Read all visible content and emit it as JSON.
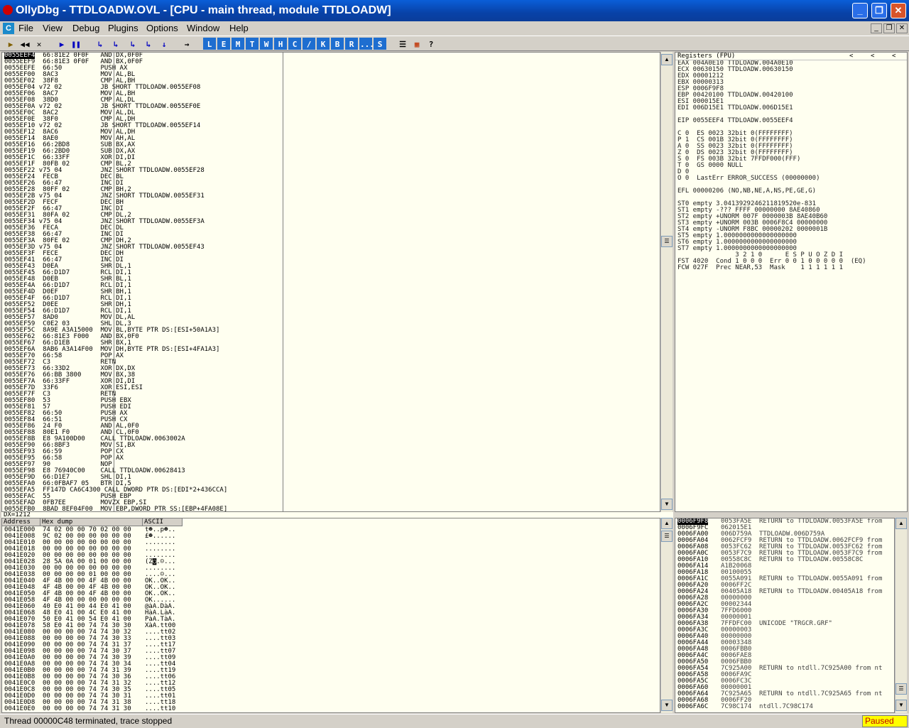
{
  "window": {
    "title": "OllyDbg - TTDLOADW.OVL - [CPU - main thread, module TTDLOADW]",
    "minimize": "_",
    "restore": "❐",
    "close": "✕"
  },
  "menu": {
    "sys": "C",
    "items": [
      "File",
      "View",
      "Debug",
      "Plugins",
      "Options",
      "Window",
      "Help"
    ],
    "mdi_min": "_",
    "mdi_restore": "❐",
    "mdi_close": "✕"
  },
  "toolbar": {
    "buttons": [
      "▶",
      "◀◀",
      "✕",
      "▶",
      "❚❚",
      "↳",
      "↳",
      "↳",
      "↳",
      "↓",
      "↑",
      "→"
    ],
    "letters": [
      "L",
      "E",
      "M",
      "T",
      "W",
      "H",
      "C",
      "/",
      "K",
      "B",
      "R",
      "...",
      "S"
    ],
    "extra": [
      "☰",
      "▦",
      "?"
    ]
  },
  "disasm": {
    "scroll_up": "▲",
    "scroll_down": "▼",
    "scroll_mid": "☰",
    "rows": [
      "0055EEF4  66:81E2 0F0F   AND DX,0F0F",
      "0055EEF9  66:81E3 0F0F   AND BX,0F0F",
      "0055EEFE  66:50          PUSH AX",
      "0055EF00  8AC3           MOV AL,BL",
      "0055EF02  38F8           CMP AL,BH",
      "0055EF04 v72 02          JB SHORT TTDLOADW.0055EF08",
      "0055EF06  8AC7           MOV AL,BH",
      "0055EF08  38D0           CMP AL,DL",
      "0055EF0A v72 02          JB SHORT TTDLOADW.0055EF0E",
      "0055EF0C  8AC2           MOV AL,DL",
      "0055EF0E  38F0           CMP AL,DH",
      "0055EF10 v72 02          JB SHORT TTDLOADW.0055EF14",
      "0055EF12  8AC6           MOV AL,DH",
      "0055EF14  8AE0           MOV AH,AL",
      "0055EF16  66:2BD8        SUB BX,AX",
      "0055EF19  66:2BD0        SUB DX,AX",
      "0055EF1C  66:33FF        XOR DI,DI",
      "0055EF1F  80FB 02        CMP BL,2",
      "0055EF22 v75 04          JNZ SHORT TTDLOADW.0055EF28",
      "0055EF24  FECB           DEC BL",
      "0055EF26  66:47          INC DI",
      "0055EF28  80FF 02        CMP BH,2",
      "0055EF2B v75 04          JNZ SHORT TTDLOADW.0055EF31",
      "0055EF2D  FECF           DEC BH",
      "0055EF2F  66:47          INC DI",
      "0055EF31  80FA 02        CMP DL,2",
      "0055EF34 v75 04          JNZ SHORT TTDLOADW.0055EF3A",
      "0055EF36  FECA           DEC DL",
      "0055EF38  66:47          INC DI",
      "0055EF3A  80FE 02        CMP DH,2",
      "0055EF3D v75 04          JNZ SHORT TTDLOADW.0055EF43",
      "0055EF3F  FECE           DEC DH",
      "0055EF41  66:47          INC DI",
      "0055EF43  D0EA           SHR DL,1",
      "0055EF45  66:D1D7        RCL DI,1",
      "0055EF48  D0EB           SHR BL,1",
      "0055EF4A  66:D1D7        RCL DI,1",
      "0055EF4D  D0EF           SHR BH,1",
      "0055EF4F  66:D1D7        RCL DI,1",
      "0055EF52  D0EE           SHR DH,1",
      "0055EF54  66:D1D7        RCL DI,1",
      "0055EF57  8AD0           MOV DL,AL",
      "0055EF59  C0E2 03        SHL DL,3",
      "0055EF5C  8A9E A3A15000  MOV BL,BYTE PTR DS:[ESI+50A1A3]",
      "0055EF62  66:81E3 F000   AND BX,0F0",
      "0055EF67  66:D1EB        SHR BX,1",
      "0055EF6A  8AB6 A3A14F00  MOV DH,BYTE PTR DS:[ESI+4FA1A3]",
      "0055EF70  66:58          POP AX",
      "0055EF72  C3             RETN",
      "0055EF73  66:33D2        XOR DX,DX",
      "0055EF76  66:BB 3800     MOV BX,38",
      "0055EF7A  66:33FF        XOR DI,DI",
      "0055EF7D  33F6           XOR ESI,ESI",
      "0055EF7F  C3             RETN",
      "0055EF80  53             PUSH EBX",
      "0055EF81  57             PUSH EDI",
      "0055EF82  66:50          PUSH AX",
      "0055EF84  66:51          PUSH CX",
      "0055EF86  24 F0          AND AL,0F0",
      "0055EF88  80E1 F0        AND CL,0F0",
      "0055EF8B  E8 9A100D00    CALL TTDLOADW.0063002A",
      "0055EF90  66:8BF3        MOV SI,BX",
      "0055EF93  66:59          POP CX",
      "0055EF95  66:58          POP AX",
      "0055EF97  90             NOP",
      "0055EF98  E8 76940C00    CALL TTDLOADW.00628413",
      "0055EF9D  66:D1E7        SHL DI,1",
      "0055EFA0  66:0FBAF7 05   BTR DI,5",
      "0055EFA5  FF147D CA6C4300 CALL DWORD PTR DS:[EDI*2+436CCA]",
      "0055EFAC  55             PUSH EBP",
      "0055EFAD  0FB7EE         MOVZX EBP,SI",
      "0055EFB0  8BAD 8EF04F00  MOV EBP,DWORD PTR SS:[EBP+4FA08E]"
    ]
  },
  "info": {
    "text": "DX=1212"
  },
  "registers": {
    "header": "Registers (FPU)",
    "arrows": [
      "<",
      "<",
      "<"
    ],
    "rows": [
      "EAX 004A0E10 TTDLOADW.004A0E10",
      "ECX 00630150 TTDLOADW.00630150",
      "EDX 00001212",
      "EBX 00000313",
      "ESP 0006F9F8",
      "EBP 00420100 TTDLOADW.00420100",
      "ESI 000015E1",
      "EDI 006D15E1 TTDLOADW.006D15E1",
      "",
      "EIP 0055EEF4 TTDLOADW.0055EEF4",
      "",
      "C 0  ES 0023 32bit 0(FFFFFFFF)",
      "P 1  CS 001B 32bit 0(FFFFFFFF)",
      "A 0  SS 0023 32bit 0(FFFFFFFF)",
      "Z 0  DS 0023 32bit 0(FFFFFFFF)",
      "S 0  FS 003B 32bit 7FFDF000(FFF)",
      "T 0  GS 0000 NULL",
      "D 0",
      "O 0  LastErr ERROR_SUCCESS (00000000)",
      "",
      "EFL 00000206 (NO,NB,NE,A,NS,PE,GE,G)",
      "",
      "ST0 empty 3.0413929246211819520e-831",
      "ST1 empty -??? FFFF 00000000 8AE40860",
      "ST2 empty +UNORM 007F 0000003B 8AE40B60",
      "ST3 empty +UNORM 003B 0006F8C4 00000000",
      "ST4 empty -UNORM F8BC 00000202 0000001B",
      "ST5 empty 1.0000000000000000000",
      "ST6 empty 1.0000000000000000000",
      "ST7 empty 1.0000000000000000000",
      "               3 2 1 0      E S P U O Z D I",
      "FST 4020  Cond 1 0 0 0  Err 0 0 1 0 0 0 0 0  (EQ)",
      "FCW 027F  Prec NEAR,53  Mask    1 1 1 1 1 1"
    ]
  },
  "dump": {
    "headers": [
      "Address",
      "Hex dump",
      "ASCII"
    ],
    "rows": [
      [
        "0041E000",
        "74 02 00 00 70 02 00 00",
        "t☻..p☻.."
      ],
      [
        "0041E008",
        "9C 02 00 00 00 00 00 00",
        "£☻......"
      ],
      [
        "0041E010",
        "00 00 00 00 00 00 00 00",
        "........"
      ],
      [
        "0041E018",
        "00 00 00 00 00 00 00 00",
        "........"
      ],
      [
        "0041E020",
        "00 00 00 00 00 00 00 00",
        "........"
      ],
      [
        "0041E028",
        "28 5A 0A 00 01 00 00 00",
        "(Z◙.☺..."
      ],
      [
        "0041E030",
        "00 00 00 00 00 00 00 00",
        "........"
      ],
      [
        "0041E038",
        "00 00 00 00 01 00 00 00",
        "....☺..."
      ],
      [
        "0041E040",
        "4F 4B 00 00 4F 4B 00 00",
        "OK..OK.."
      ],
      [
        "0041E048",
        "4F 4B 00 00 4F 4B 00 00",
        "OK..OK.."
      ],
      [
        "0041E050",
        "4F 4B 00 00 4F 4B 00 00",
        "OK..OK.."
      ],
      [
        "0041E058",
        "4F 4B 00 00 00 00 00 00",
        "OK......"
      ],
      [
        "0041E060",
        "40 E0 41 00 44 E0 41 00",
        "@àA.DàA."
      ],
      [
        "0041E068",
        "48 E0 41 00 4C E0 41 00",
        "HàA.LàA."
      ],
      [
        "0041E070",
        "50 E0 41 00 54 E0 41 00",
        "PàA.TàA."
      ],
      [
        "0041E078",
        "58 E0 41 00 74 74 30 30",
        "XàA.tt00"
      ],
      [
        "0041E080",
        "00 00 00 00 74 74 30 32",
        "....tt02"
      ],
      [
        "0041E088",
        "00 00 00 00 74 74 30 33",
        "....tt03"
      ],
      [
        "0041E090",
        "00 00 00 00 74 74 31 37",
        "....tt17"
      ],
      [
        "0041E098",
        "00 00 00 00 74 74 30 37",
        "....tt07"
      ],
      [
        "0041E0A0",
        "00 00 00 00 74 74 30 39",
        "....tt09"
      ],
      [
        "0041E0A8",
        "00 00 00 00 74 74 30 34",
        "....tt04"
      ],
      [
        "0041E0B0",
        "00 00 00 00 74 74 31 39",
        "....tt19"
      ],
      [
        "0041E0B8",
        "00 00 00 00 74 74 30 36",
        "....tt06"
      ],
      [
        "0041E0C0",
        "00 00 00 00 74 74 31 32",
        "....tt12"
      ],
      [
        "0041E0C8",
        "00 00 00 00 74 74 30 35",
        "....tt05"
      ],
      [
        "0041E0D0",
        "00 00 00 00 74 74 30 31",
        "....tt01"
      ],
      [
        "0041E0D8",
        "00 00 00 00 74 74 31 38",
        "....tt18"
      ],
      [
        "0041E0E0",
        "00 00 00 00 74 74 31 30",
        "....tt10"
      ]
    ]
  },
  "stack": {
    "rows": [
      [
        "0006F9F8",
        "0053FA5E",
        "RETURN to TTDLOADW.0053FA5E from"
      ],
      [
        "0006F9FC",
        "062015E1",
        ""
      ],
      [
        "0006FA00",
        "006D759A",
        "TTDLOADW.006D759A"
      ],
      [
        "0006FA04",
        "0062FCF9",
        "RETURN to TTDLOADW.0062FCF9 from"
      ],
      [
        "0006FA08",
        "0053FC62",
        "RETURN to TTDLOADW.0053FC62 from"
      ],
      [
        "0006FA0C",
        "0053F7C9",
        "RETURN to TTDLOADW.0053F7C9 from"
      ],
      [
        "0006FA10",
        "00558C8C",
        "RETURN to TTDLOADW.00558C8C"
      ],
      [
        "0006FA14",
        "A1B20068",
        ""
      ],
      [
        "0006FA18",
        "00100055",
        ""
      ],
      [
        "0006FA1C",
        "0055A091",
        "RETURN to TTDLOADW.0055A091 from"
      ],
      [
        "0006FA20",
        "0006FF2C",
        ""
      ],
      [
        "0006FA24",
        "00405A18",
        "RETURN to TTDLOADW.00405A18 from"
      ],
      [
        "0006FA28",
        "00000000",
        ""
      ],
      [
        "0006FA2C",
        "00002344",
        ""
      ],
      [
        "0006FA30",
        "7FFD6000",
        ""
      ],
      [
        "0006FA34",
        "00000001",
        ""
      ],
      [
        "0006FA38",
        "7FFDFC00",
        "UNICODE \"TRGCR.GRF\""
      ],
      [
        "0006FA3C",
        "00000003",
        ""
      ],
      [
        "0006FA40",
        "00000000",
        ""
      ],
      [
        "0006FA44",
        "00003348",
        ""
      ],
      [
        "0006FA48",
        "0006FBB0",
        ""
      ],
      [
        "0006FA4C",
        "0006FAE8",
        ""
      ],
      [
        "0006FA50",
        "0006FBB0",
        ""
      ],
      [
        "0006FA54",
        "7C925A00",
        "RETURN to ntdll.7C925A00 from nt"
      ],
      [
        "0006FA58",
        "0006FA9C",
        ""
      ],
      [
        "0006FA5C",
        "0006FC3C",
        ""
      ],
      [
        "0006FA60",
        "00000001",
        ""
      ],
      [
        "0006FA64",
        "7C925A65",
        "RETURN to ntdll.7C925A65 from nt"
      ],
      [
        "0006FA68",
        "0006FF20",
        ""
      ],
      [
        "0006FA6C",
        "7C98C174",
        "ntdll.7C98C174"
      ]
    ]
  },
  "status": {
    "text": "Thread 00000C48 terminated, trace stopped",
    "state": "Paused"
  }
}
